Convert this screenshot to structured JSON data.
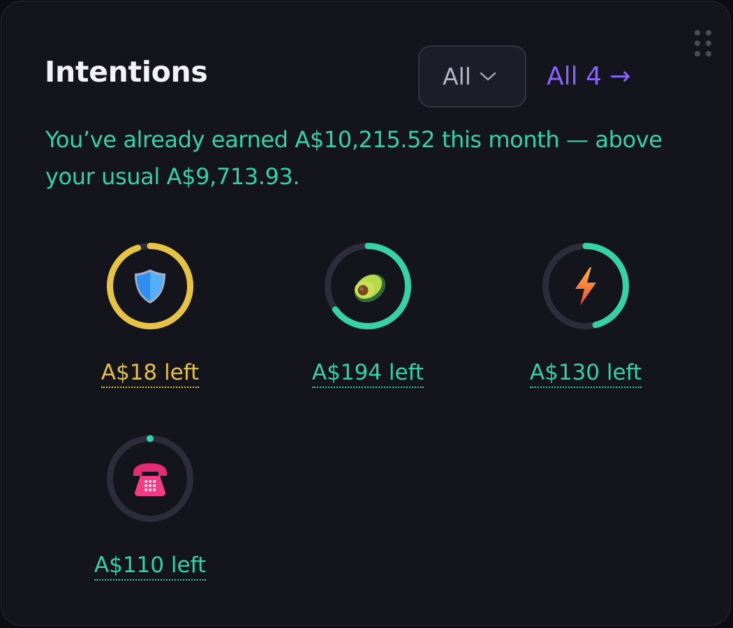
{
  "widget": {
    "title": "Intentions",
    "filter": {
      "selected": "All"
    },
    "view_all_label": "All 4 →",
    "summary": "You’ve already earned A$10,215.52 this month — above your usual A$9,713.93."
  },
  "intentions": [
    {
      "icon": "shield-icon",
      "left_label": "A$18 left",
      "progress": 0.95,
      "status": "warning",
      "ring_color": "#e6c345"
    },
    {
      "icon": "avocado-icon",
      "left_label": "A$194 left",
      "progress": 0.65,
      "status": "ok",
      "ring_color": "#36d2a6"
    },
    {
      "icon": "lightning-icon",
      "left_label": "A$130 left",
      "progress": 0.46,
      "status": "ok",
      "ring_color": "#36d2a6"
    },
    {
      "icon": "telephone-icon",
      "left_label": "A$110 left",
      "progress": 0.0,
      "status": "ok",
      "ring_color": "#36d2a6"
    }
  ],
  "colors": {
    "card_background": "#14141d",
    "ring_track": "#2c2c3b",
    "ok": "#33d1a4",
    "warning": "#e6bf44",
    "accent_link": "#8a62ff"
  }
}
